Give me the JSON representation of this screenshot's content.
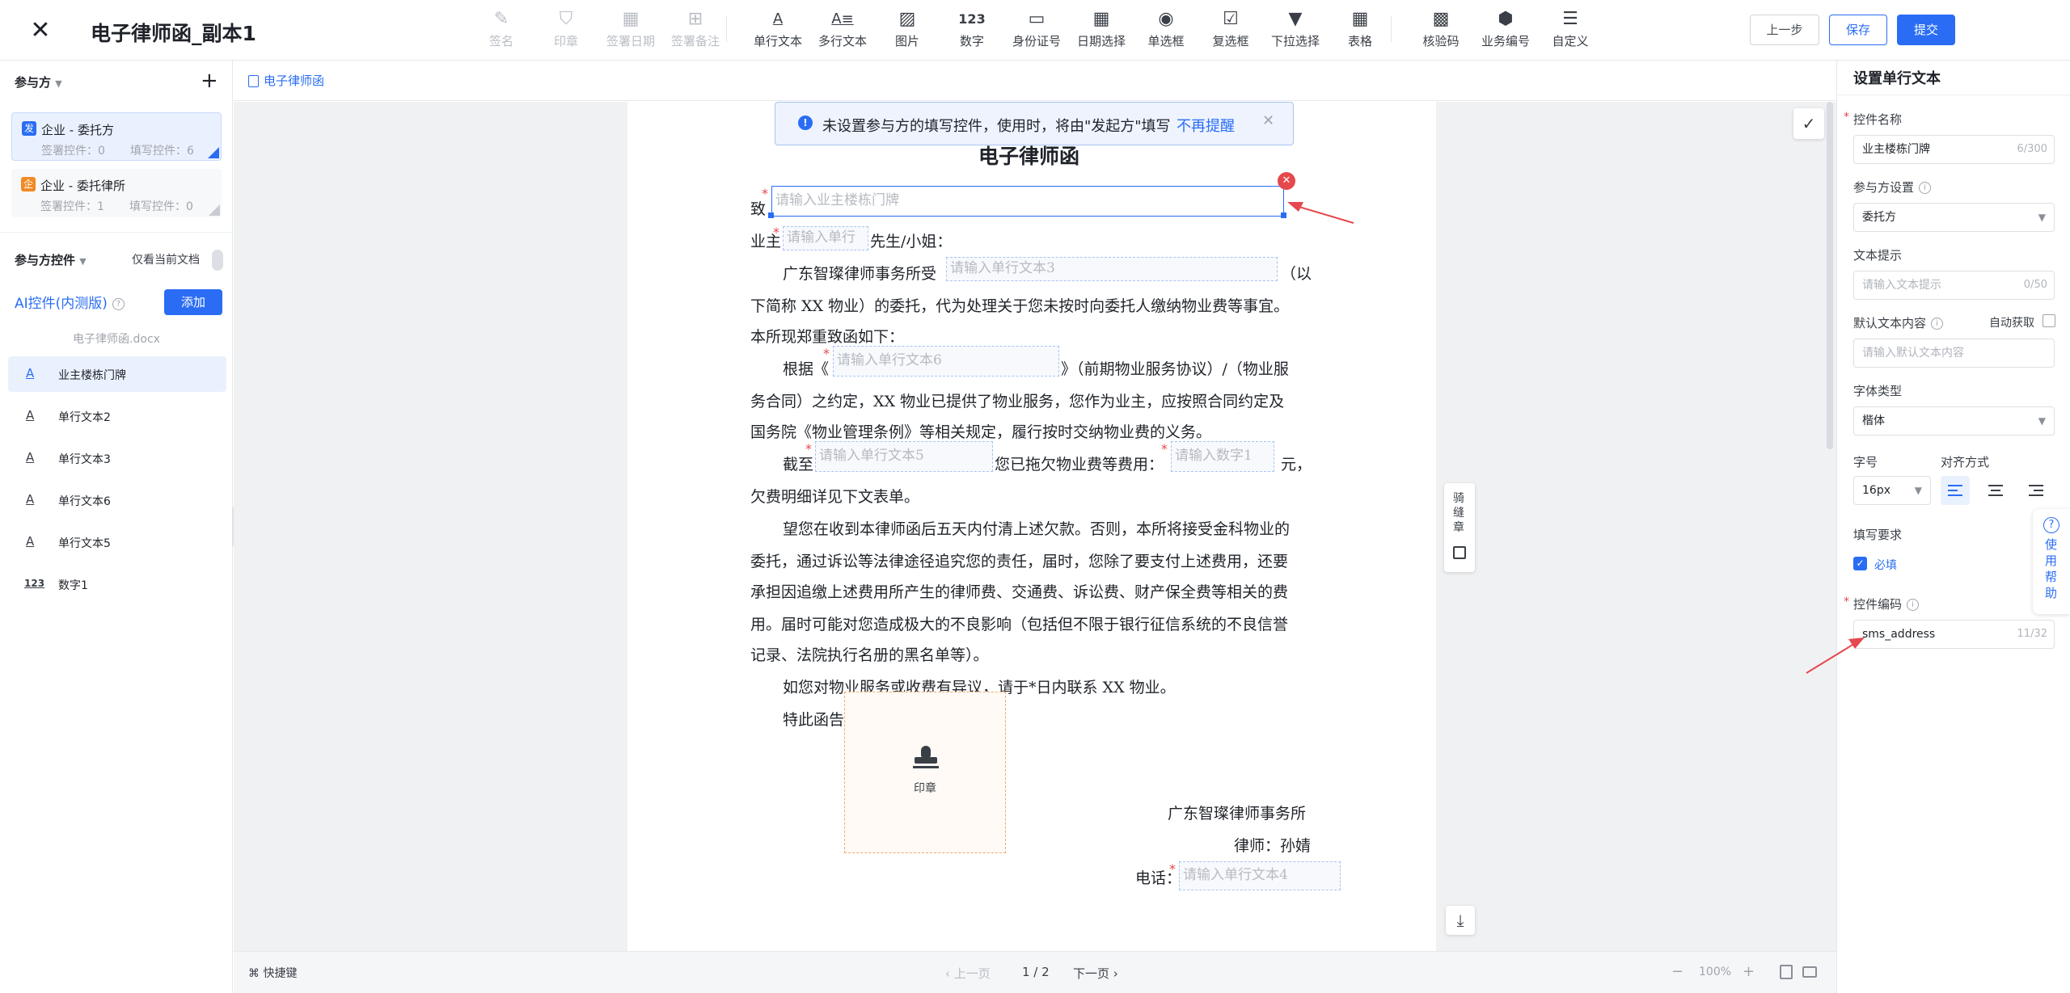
{
  "header": {
    "title": "电子律师函_副本1",
    "toolbar": [
      {
        "label": "签名",
        "icon": "pen-icon",
        "disabled": true
      },
      {
        "label": "印章",
        "icon": "stamp-icon",
        "disabled": true
      },
      {
        "label": "签署日期",
        "icon": "calendar-icon",
        "disabled": true
      },
      {
        "label": "签署备注",
        "icon": "note-plus-icon",
        "disabled": true
      },
      {
        "label": "单行文本",
        "icon": "text-a-icon",
        "disabled": false
      },
      {
        "label": "多行文本",
        "icon": "multi-text-icon",
        "disabled": false
      },
      {
        "label": "图片",
        "icon": "image-icon",
        "disabled": false
      },
      {
        "label": "数字",
        "icon": "number-123-icon",
        "disabled": false
      },
      {
        "label": "身份证号",
        "icon": "id-card-icon",
        "disabled": false
      },
      {
        "label": "日期选择",
        "icon": "date-picker-icon",
        "disabled": false
      },
      {
        "label": "单选框",
        "icon": "radio-icon",
        "disabled": false
      },
      {
        "label": "复选框",
        "icon": "checkbox-icon",
        "disabled": false
      },
      {
        "label": "下拉选择",
        "icon": "dropdown-icon",
        "disabled": false
      },
      {
        "label": "表格",
        "icon": "table-icon",
        "disabled": false
      },
      {
        "label": "核验码",
        "icon": "qr-code-icon",
        "disabled": false
      },
      {
        "label": "业务编号",
        "icon": "tag-icon",
        "disabled": false
      },
      {
        "label": "自定义",
        "icon": "sliders-icon",
        "disabled": false
      }
    ],
    "prev_label": "上一步",
    "save_label": "保存",
    "submit_label": "提交"
  },
  "sidebar": {
    "parties_title": "参与方",
    "parties": [
      {
        "tag": "发",
        "name": "企业 - 委托方",
        "sign_count": "签署控件：0",
        "fill_count": "填写控件：6",
        "tag_color": "#2a6df4"
      },
      {
        "tag": "企",
        "name": "企业 - 委托律所",
        "sign_count": "签署控件：1",
        "fill_count": "填写控件：0",
        "tag_color": "#f08a24"
      }
    ],
    "controls_title": "参与方控件",
    "only_current_label": "仅看当前文档",
    "ai_label": "AI控件(内测版)",
    "add_label": "添加",
    "file_name": "电子律师函.docx",
    "controls": [
      {
        "icon": "A",
        "label": "业主楼栋门牌"
      },
      {
        "icon": "A",
        "label": "单行文本2"
      },
      {
        "icon": "A",
        "label": "单行文本3"
      },
      {
        "icon": "A",
        "label": "单行文本6"
      },
      {
        "icon": "A",
        "label": "单行文本5"
      },
      {
        "icon": "123",
        "label": "数字1"
      }
    ]
  },
  "doc": {
    "tab_label": "电子律师函",
    "notice": "未设置参与方的填写控件，使用时，将由\"发起方\"填写",
    "notice_link": "不再提醒",
    "heading": "电子律师函",
    "line_zhi": "致",
    "field_address_ph": "请输入业主楼栋门牌",
    "line_yezhu": "业主",
    "field_text2_ph": "请输入单行",
    "line_xiansheng": "先生/小姐：",
    "para1_a": "广东智璨律师事务所受",
    "field_text3_ph": "请输入单行文本3",
    "para1_b": "（以",
    "para1_c": "下简称 XX 物业）的委托，代为处理关于您未按时向委托人缴纳物业费等事宜。",
    "para1_d": "本所现郑重致函如下：",
    "para2_a": "根据《",
    "field_text6_ph": "请输入单行文本6",
    "para2_b": "》（前期物业服务协议）/（物业服",
    "para2_c": "务合同）之约定，XX 物业已提供了物业服务，您作为业主，应按照合同约定及",
    "para2_d": "国务院《物业管理条例》等相关规定，履行按时交纳物业费的义务。",
    "para3_a": "截至",
    "field_text5_ph": "请输入单行文本5",
    "para3_b": "您已拖欠物业费等费用：",
    "field_num1_ph": "请输入数字1",
    "para3_c": "元，",
    "para3_d": "欠费明细详见下文表单。",
    "para4_a": "望您在收到本律师函后五天内付清上述欠款。否则，本所将接受金科物业的",
    "para4_b": "委托，通过诉讼等法律途径追究您的责任，届时，您除了要支付上述费用，还要",
    "para4_c": "承担因追缴上述费用所产生的律师费、交通费、诉讼费、财产保全费等相关的费",
    "para4_d": "用。届时可能对您造成极大的不良影响（包括但不限于银行征信系统的不良信誉",
    "para4_e": "记录、法院执行名册的黑名单等）。",
    "para5": "如您对物业服务或收费有异议，请于*日内联系 XX 物业。",
    "para6": "特此函告！",
    "seal_label": "印章",
    "firm": "广东智璨律师事务所",
    "lawyer": "律师：孙婧",
    "phone_label": "电话：",
    "field_text4_ph": "请输入单行文本4",
    "side_tool_label": "骑缝章"
  },
  "footer": {
    "shortcut_label": "快捷键",
    "prev_page": "上一页",
    "page_indicator": "1 / 2",
    "next_page": "下一页",
    "zoom": "100%"
  },
  "panel": {
    "title": "设置单行文本",
    "name_label": "控件名称",
    "name_value": "业主楼栋门牌",
    "name_count": "6/300",
    "party_label": "参与方设置",
    "party_value": "委托方",
    "hint_label": "文本提示",
    "hint_ph": "请输入文本提示",
    "hint_count": "0/50",
    "default_label": "默认文本内容",
    "auto_label": "自动获取",
    "default_ph": "请输入默认文本内容",
    "font_label": "字体类型",
    "font_value": "楷体",
    "size_label": "字号",
    "size_value": "16px",
    "align_label": "对齐方式",
    "fill_label": "填写要求",
    "required_label": "必填",
    "code_label": "控件编码",
    "code_value": "sms_address",
    "code_count": "11/32",
    "help_label": "使用帮助"
  }
}
